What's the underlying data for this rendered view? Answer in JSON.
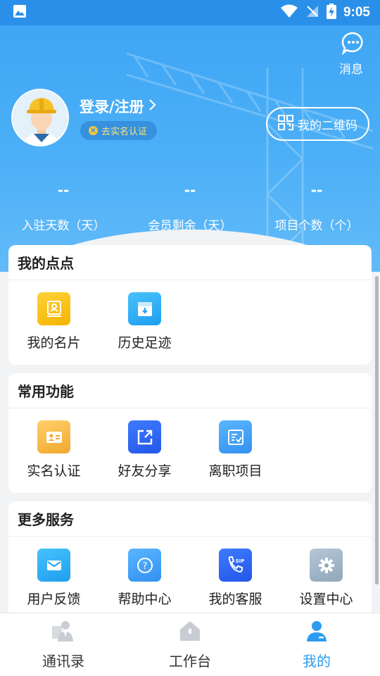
{
  "status_bar": {
    "time": "9:05",
    "icons": [
      "image-icon",
      "wifi-icon",
      "no-signal-icon",
      "battery-charging-icon"
    ]
  },
  "header": {
    "message_label": "消息",
    "login_label": "登录/注册",
    "verify_label": "去实名认证",
    "qr_label": "我的二维码",
    "stats": [
      {
        "value": "--",
        "label": "入驻天数（天）"
      },
      {
        "value": "--",
        "label": "会员剩余（天）"
      },
      {
        "value": "--",
        "label": "项目个数（个）"
      }
    ]
  },
  "sections": [
    {
      "title": "我的点点",
      "items": [
        {
          "label": "我的名片",
          "icon": "business-card-icon",
          "color": "#f5b400"
        },
        {
          "label": "历史足迹",
          "icon": "history-box-icon",
          "color": "#1e9ef0"
        }
      ]
    },
    {
      "title": "常用功能",
      "items": [
        {
          "label": "实名认证",
          "icon": "id-card-icon",
          "color": "#f0a830"
        },
        {
          "label": "好友分享",
          "icon": "share-icon",
          "color": "#2456e8"
        },
        {
          "label": "离职项目",
          "icon": "checklist-icon",
          "color": "#3391f0"
        }
      ]
    },
    {
      "title": "更多服务",
      "items": [
        {
          "label": "用户反馈",
          "icon": "mail-icon",
          "color": "#1e9ef0"
        },
        {
          "label": "帮助中心",
          "icon": "help-icon",
          "color": "#3391f0"
        },
        {
          "label": "我的客服",
          "icon": "sip-phone-icon",
          "color": "#2456e8"
        },
        {
          "label": "设置中心",
          "icon": "gear-icon",
          "color": "#8fa7bb"
        }
      ]
    }
  ],
  "bottom_nav": {
    "items": [
      {
        "label": "通讯录",
        "active": false
      },
      {
        "label": "工作台",
        "active": false
      },
      {
        "label": "我的",
        "active": true
      }
    ],
    "active_color": "#2d9bf0"
  }
}
